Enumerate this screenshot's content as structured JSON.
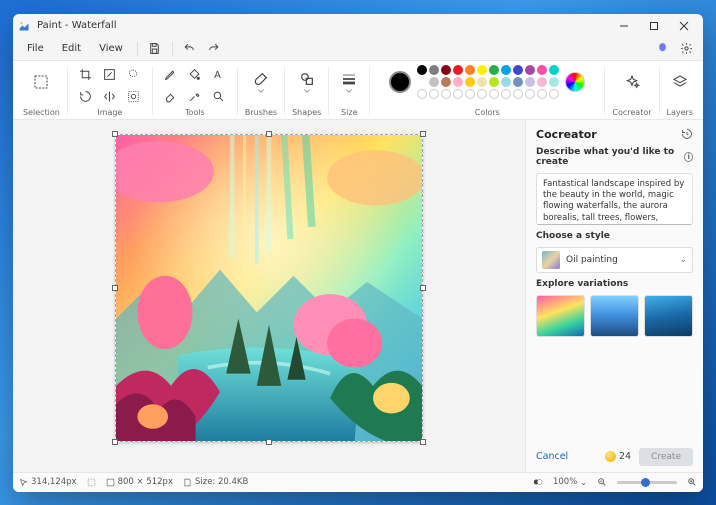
{
  "window": {
    "title": "Paint - Waterfall"
  },
  "menu": {
    "file": "File",
    "edit": "Edit",
    "view": "View"
  },
  "ribbon": {
    "selection": "Selection",
    "image": "Image",
    "tools": "Tools",
    "brushes": "Brushes",
    "shapes": "Shapes",
    "size": "Size",
    "colors": "Colors",
    "cocreator": "Cocreator",
    "layers": "Layers"
  },
  "colors": {
    "current": "#000000",
    "row1": [
      "#000000",
      "#7f7f7f",
      "#880015",
      "#ed1c24",
      "#ff7f27",
      "#fff200",
      "#22b14c",
      "#00a2e8",
      "#3f48cc",
      "#a349a4",
      "#ff4fa3",
      "#00d3c5"
    ],
    "row2": [
      "#ffffff",
      "#c3c3c3",
      "#b97a57",
      "#ffaec9",
      "#ffc90e",
      "#efe4b0",
      "#b5e61d",
      "#99d9ea",
      "#7092be",
      "#c8bfe7",
      "#f5b7d5",
      "#a0e7e5"
    ]
  },
  "cocreator": {
    "title": "Cocreator",
    "describe_label": "Describe what you'd like to create",
    "prompt": "Fantastical landscape inspired by the beauty in the world, magic flowing waterfalls, the aurora borealis, tall trees, flowers, plants and a pink, yellow and blue sky.",
    "style_label": "Choose a style",
    "style_value": "Oil painting",
    "variations_label": "Explore variations",
    "cancel": "Cancel",
    "credits": "24",
    "create": "Create"
  },
  "status": {
    "cursor": "314,124px",
    "canvas_size": "800 × 512px",
    "file_size": "Size: 20.4KB",
    "zoom": "100%"
  }
}
